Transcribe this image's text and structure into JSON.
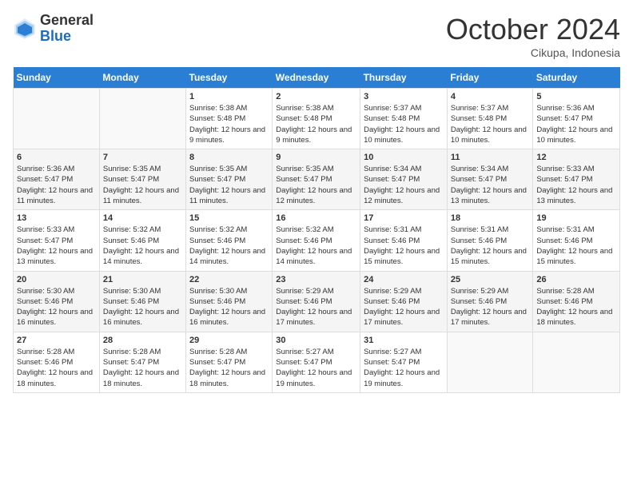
{
  "logo": {
    "general": "General",
    "blue": "Blue"
  },
  "title": "October 2024",
  "location": "Cikupa, Indonesia",
  "days_of_week": [
    "Sunday",
    "Monday",
    "Tuesday",
    "Wednesday",
    "Thursday",
    "Friday",
    "Saturday"
  ],
  "weeks": [
    [
      {
        "day": null,
        "sunrise": null,
        "sunset": null,
        "daylight": null
      },
      {
        "day": null,
        "sunrise": null,
        "sunset": null,
        "daylight": null
      },
      {
        "day": "1",
        "sunrise": "Sunrise: 5:38 AM",
        "sunset": "Sunset: 5:48 PM",
        "daylight": "Daylight: 12 hours and 9 minutes."
      },
      {
        "day": "2",
        "sunrise": "Sunrise: 5:38 AM",
        "sunset": "Sunset: 5:48 PM",
        "daylight": "Daylight: 12 hours and 9 minutes."
      },
      {
        "day": "3",
        "sunrise": "Sunrise: 5:37 AM",
        "sunset": "Sunset: 5:48 PM",
        "daylight": "Daylight: 12 hours and 10 minutes."
      },
      {
        "day": "4",
        "sunrise": "Sunrise: 5:37 AM",
        "sunset": "Sunset: 5:48 PM",
        "daylight": "Daylight: 12 hours and 10 minutes."
      },
      {
        "day": "5",
        "sunrise": "Sunrise: 5:36 AM",
        "sunset": "Sunset: 5:47 PM",
        "daylight": "Daylight: 12 hours and 10 minutes."
      }
    ],
    [
      {
        "day": "6",
        "sunrise": "Sunrise: 5:36 AM",
        "sunset": "Sunset: 5:47 PM",
        "daylight": "Daylight: 12 hours and 11 minutes."
      },
      {
        "day": "7",
        "sunrise": "Sunrise: 5:35 AM",
        "sunset": "Sunset: 5:47 PM",
        "daylight": "Daylight: 12 hours and 11 minutes."
      },
      {
        "day": "8",
        "sunrise": "Sunrise: 5:35 AM",
        "sunset": "Sunset: 5:47 PM",
        "daylight": "Daylight: 12 hours and 11 minutes."
      },
      {
        "day": "9",
        "sunrise": "Sunrise: 5:35 AM",
        "sunset": "Sunset: 5:47 PM",
        "daylight": "Daylight: 12 hours and 12 minutes."
      },
      {
        "day": "10",
        "sunrise": "Sunrise: 5:34 AM",
        "sunset": "Sunset: 5:47 PM",
        "daylight": "Daylight: 12 hours and 12 minutes."
      },
      {
        "day": "11",
        "sunrise": "Sunrise: 5:34 AM",
        "sunset": "Sunset: 5:47 PM",
        "daylight": "Daylight: 12 hours and 13 minutes."
      },
      {
        "day": "12",
        "sunrise": "Sunrise: 5:33 AM",
        "sunset": "Sunset: 5:47 PM",
        "daylight": "Daylight: 12 hours and 13 minutes."
      }
    ],
    [
      {
        "day": "13",
        "sunrise": "Sunrise: 5:33 AM",
        "sunset": "Sunset: 5:47 PM",
        "daylight": "Daylight: 12 hours and 13 minutes."
      },
      {
        "day": "14",
        "sunrise": "Sunrise: 5:32 AM",
        "sunset": "Sunset: 5:46 PM",
        "daylight": "Daylight: 12 hours and 14 minutes."
      },
      {
        "day": "15",
        "sunrise": "Sunrise: 5:32 AM",
        "sunset": "Sunset: 5:46 PM",
        "daylight": "Daylight: 12 hours and 14 minutes."
      },
      {
        "day": "16",
        "sunrise": "Sunrise: 5:32 AM",
        "sunset": "Sunset: 5:46 PM",
        "daylight": "Daylight: 12 hours and 14 minutes."
      },
      {
        "day": "17",
        "sunrise": "Sunrise: 5:31 AM",
        "sunset": "Sunset: 5:46 PM",
        "daylight": "Daylight: 12 hours and 15 minutes."
      },
      {
        "day": "18",
        "sunrise": "Sunrise: 5:31 AM",
        "sunset": "Sunset: 5:46 PM",
        "daylight": "Daylight: 12 hours and 15 minutes."
      },
      {
        "day": "19",
        "sunrise": "Sunrise: 5:31 AM",
        "sunset": "Sunset: 5:46 PM",
        "daylight": "Daylight: 12 hours and 15 minutes."
      }
    ],
    [
      {
        "day": "20",
        "sunrise": "Sunrise: 5:30 AM",
        "sunset": "Sunset: 5:46 PM",
        "daylight": "Daylight: 12 hours and 16 minutes."
      },
      {
        "day": "21",
        "sunrise": "Sunrise: 5:30 AM",
        "sunset": "Sunset: 5:46 PM",
        "daylight": "Daylight: 12 hours and 16 minutes."
      },
      {
        "day": "22",
        "sunrise": "Sunrise: 5:30 AM",
        "sunset": "Sunset: 5:46 PM",
        "daylight": "Daylight: 12 hours and 16 minutes."
      },
      {
        "day": "23",
        "sunrise": "Sunrise: 5:29 AM",
        "sunset": "Sunset: 5:46 PM",
        "daylight": "Daylight: 12 hours and 17 minutes."
      },
      {
        "day": "24",
        "sunrise": "Sunrise: 5:29 AM",
        "sunset": "Sunset: 5:46 PM",
        "daylight": "Daylight: 12 hours and 17 minutes."
      },
      {
        "day": "25",
        "sunrise": "Sunrise: 5:29 AM",
        "sunset": "Sunset: 5:46 PM",
        "daylight": "Daylight: 12 hours and 17 minutes."
      },
      {
        "day": "26",
        "sunrise": "Sunrise: 5:28 AM",
        "sunset": "Sunset: 5:46 PM",
        "daylight": "Daylight: 12 hours and 18 minutes."
      }
    ],
    [
      {
        "day": "27",
        "sunrise": "Sunrise: 5:28 AM",
        "sunset": "Sunset: 5:46 PM",
        "daylight": "Daylight: 12 hours and 18 minutes."
      },
      {
        "day": "28",
        "sunrise": "Sunrise: 5:28 AM",
        "sunset": "Sunset: 5:47 PM",
        "daylight": "Daylight: 12 hours and 18 minutes."
      },
      {
        "day": "29",
        "sunrise": "Sunrise: 5:28 AM",
        "sunset": "Sunset: 5:47 PM",
        "daylight": "Daylight: 12 hours and 18 minutes."
      },
      {
        "day": "30",
        "sunrise": "Sunrise: 5:27 AM",
        "sunset": "Sunset: 5:47 PM",
        "daylight": "Daylight: 12 hours and 19 minutes."
      },
      {
        "day": "31",
        "sunrise": "Sunrise: 5:27 AM",
        "sunset": "Sunset: 5:47 PM",
        "daylight": "Daylight: 12 hours and 19 minutes."
      },
      {
        "day": null,
        "sunrise": null,
        "sunset": null,
        "daylight": null
      },
      {
        "day": null,
        "sunrise": null,
        "sunset": null,
        "daylight": null
      }
    ]
  ]
}
